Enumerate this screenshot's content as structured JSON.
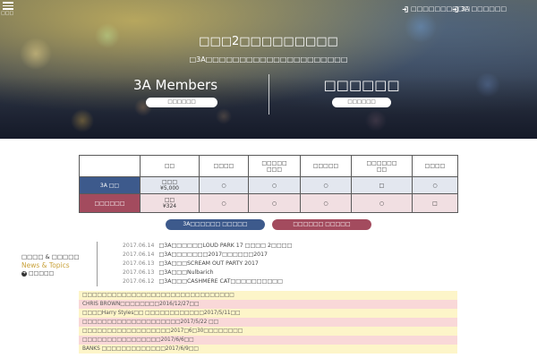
{
  "header": {
    "menu_label": "□□□",
    "links": [
      "□□□□□□□□□□",
      "3A □□□□□□"
    ]
  },
  "hero": {
    "title": "□□□2□□□□□□□□□",
    "subtitle": "□3A□□□□□□□□□□□□□□□□□□□□□",
    "left": {
      "heading": "3A Members",
      "button": "□□□□□□"
    },
    "right": {
      "heading": "□□□□□□",
      "button": "□□□□□□"
    }
  },
  "colors": {
    "member_blue": "#3d5a8c",
    "guest_red": "#a34b5e",
    "notice_yellow": "#fdf5c9",
    "notice_pink": "#f9d8d8"
  },
  "plans": {
    "headers": [
      "□□",
      "□□□□",
      "□□□□□\n□□□",
      "□□□□□",
      "□□□□□□\n□□",
      "□□□□"
    ],
    "rows": [
      {
        "label": "3A □□",
        "color": "member_blue",
        "plan": "□□□",
        "price": "¥5,000",
        "marks": [
          "○",
          "○",
          "○",
          "□",
          "○"
        ]
      },
      {
        "label": "□□□□□□",
        "color": "guest_red",
        "plan": "□□",
        "price": "¥324",
        "marks": [
          "○",
          "○",
          "○",
          "○",
          "□"
        ]
      }
    ]
  },
  "cta_buttons": [
    "3A□□□□□□ □□□□□",
    "□□□□□□ □□□□□"
  ],
  "news": {
    "heading_ja": "□□□□ & □□□□□",
    "heading_en": "News & Topics",
    "more": "□□□□□",
    "items": [
      {
        "date": "2017.06.14",
        "text": "□3A□□□□□□LOUD PARK 17 □□□□ 2□□□□"
      },
      {
        "date": "2017.06.14",
        "text": "□3A□□□□□□□2017□□□□□□2017"
      },
      {
        "date": "2017.06.13",
        "text": "□3A□□□SCREAM OUT PARTY 2017"
      },
      {
        "date": "2017.06.13",
        "text": "□3A□□□Nulbarich"
      },
      {
        "date": "2017.06.12",
        "text": "□3A□□□CASHMERE CAT□□□□□□□□□□"
      }
    ]
  },
  "notices": [
    {
      "text": "□□□□□□□□□□□□□□□□□□□□□□□□□□□□□□□",
      "tone": "notice_yellow"
    },
    {
      "text": "CHRIS BROWN□□□□□□□□2016/12/27□□",
      "tone": "notice_pink"
    },
    {
      "text": "□□□□Harry Styles□□ □□□□□□□□□□□□2017/5/11□□",
      "tone": "notice_yellow"
    },
    {
      "text": "□□□□□□□□□□□□□□□□□□□□2017/5/22 □□",
      "tone": "notice_pink"
    },
    {
      "text": "□□□□□□□□□□□□□□□□□□2017□6□30□□□□□□□□",
      "tone": "notice_yellow"
    },
    {
      "text": "□□□□□□□□□□□□□□□□2017/6/6□□",
      "tone": "notice_pink"
    },
    {
      "text": "BANKS □□□□□□□□□□□□□2017/6/9□□",
      "tone": "notice_yellow"
    }
  ]
}
